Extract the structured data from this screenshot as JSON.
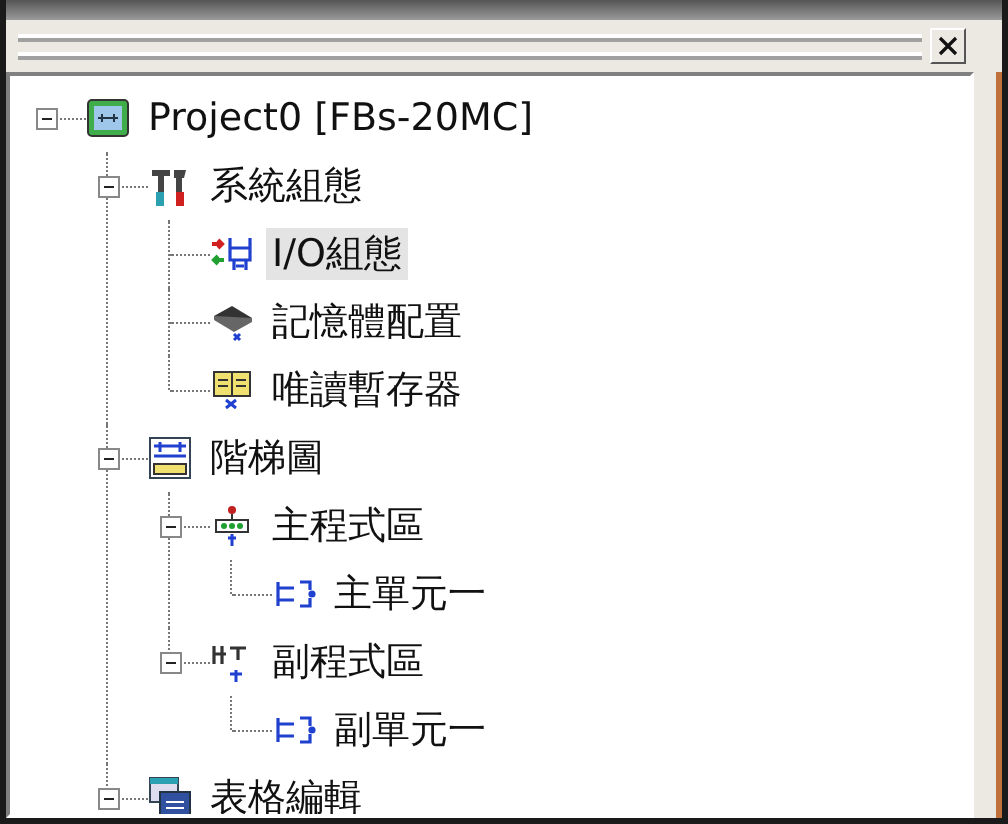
{
  "tree": [
    {
      "label": "Project0 [FBs-20MC]",
      "kind": "project",
      "expanded": true,
      "selected": false,
      "children": [
        {
          "label": "系統組態",
          "kind": "tools",
          "expanded": true,
          "selected": false,
          "children": [
            {
              "label": "I/O組態",
              "kind": "io",
              "selected": true
            },
            {
              "label": "記憶體配置",
              "kind": "memory",
              "selected": false
            },
            {
              "label": "唯讀暫存器",
              "kind": "rom",
              "selected": false
            }
          ]
        },
        {
          "label": "階梯圖",
          "kind": "ladder",
          "expanded": true,
          "selected": false,
          "children": [
            {
              "label": "主程式區",
              "kind": "main",
              "expanded": true,
              "selected": false,
              "children": [
                {
                  "label": "主單元一",
                  "kind": "unit",
                  "selected": false
                }
              ]
            },
            {
              "label": "副程式區",
              "kind": "sub",
              "expanded": true,
              "selected": false,
              "children": [
                {
                  "label": "副單元一",
                  "kind": "unit",
                  "selected": false
                }
              ]
            }
          ]
        },
        {
          "label": "表格編輯",
          "kind": "table",
          "expanded": true,
          "selected": false
        }
      ]
    }
  ]
}
